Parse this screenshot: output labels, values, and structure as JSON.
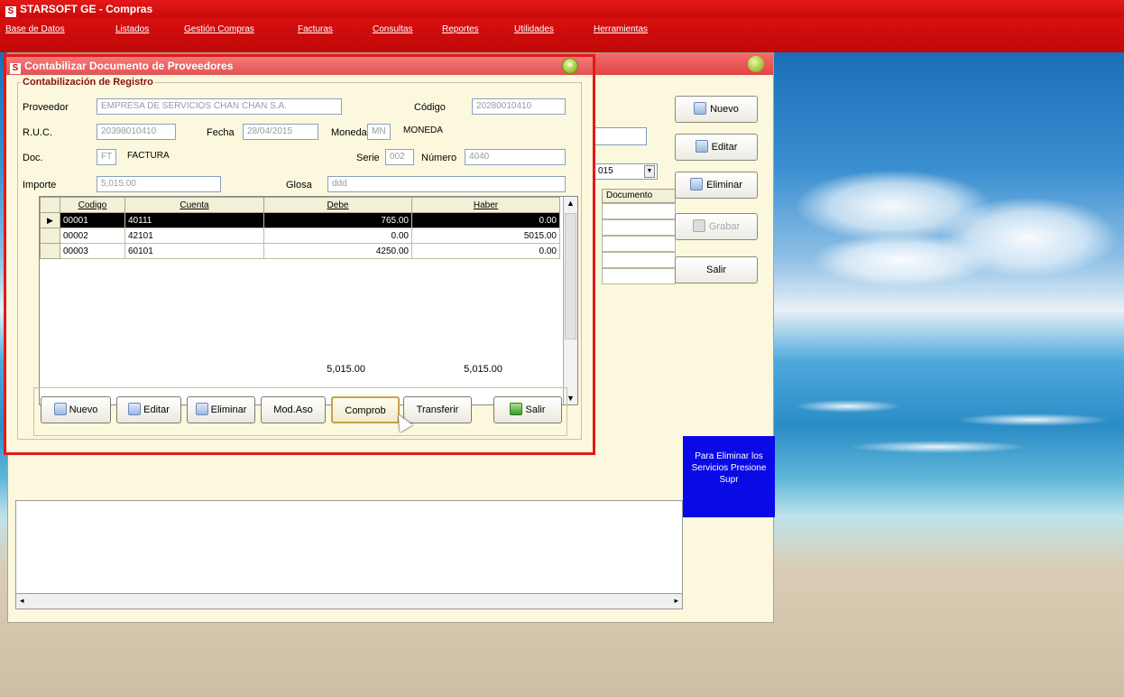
{
  "app": {
    "title": "STARSOFT GE - Compras",
    "logo_letter": "S"
  },
  "menu": [
    {
      "label": "Base de Datos"
    },
    {
      "label": "Listados"
    },
    {
      "label": "Gestión Compras"
    },
    {
      "label": "Facturas"
    },
    {
      "label": "Consultas"
    },
    {
      "label": "Reportes"
    },
    {
      "label": "Utilidades"
    },
    {
      "label": "Herramientas"
    }
  ],
  "background_window": {
    "year_value": "015",
    "grid_header": "Documento",
    "side_buttons": [
      {
        "label": "Nuevo",
        "enabled": true
      },
      {
        "label": "Editar",
        "enabled": true
      },
      {
        "label": "Eliminar",
        "enabled": true
      },
      {
        "label": "Grabar",
        "enabled": false
      },
      {
        "label": "Salir",
        "enabled": true
      }
    ],
    "info_text": "Para Eliminar los Servicios Presione Supr"
  },
  "modal": {
    "title": "Contabilizar Documento de Proveedores",
    "close_glyph": "×",
    "group_legend": "Contabilización de Registro",
    "fields": {
      "proveedor_label": "Proveedor",
      "proveedor_value": "EMPRESA DE SERVICIOS CHAN CHAN S.A.",
      "codigo_label": "Código",
      "codigo_value": "20280010410",
      "ruc_label": "R.U.C.",
      "ruc_value": "20398010410",
      "fecha_label": "Fecha",
      "fecha_value": "28/04/2015",
      "moneda_label": "Moneda",
      "moneda_code": "MN",
      "moneda_name": "MONEDA",
      "doc_label": "Doc.",
      "doc_code": "FT",
      "doc_name": "FACTURA",
      "serie_label": "Serie",
      "serie_value": "002",
      "numero_label": "Número",
      "numero_value": "4040",
      "importe_label": "Importe",
      "importe_value": "5,015.00",
      "glosa_label": "Glosa",
      "glosa_value": "ddd"
    },
    "grid": {
      "columns": [
        "Codigo",
        "Cuenta",
        "Debe",
        "Haber"
      ],
      "rows": [
        {
          "codigo": "00001",
          "cuenta": "40111",
          "debe": "765.00",
          "haber": "0.00",
          "active": true
        },
        {
          "codigo": "00002",
          "cuenta": "42101",
          "debe": "0.00",
          "haber": "5015.00",
          "active": false
        },
        {
          "codigo": "00003",
          "cuenta": "60101",
          "debe": "4250.00",
          "haber": "0.00",
          "active": false
        }
      ],
      "total_debe": "5,015.00",
      "total_haber": "5,015.00"
    },
    "buttons": [
      {
        "label": "Nuevo"
      },
      {
        "label": "Editar"
      },
      {
        "label": "Eliminar"
      },
      {
        "label": "Mod.Aso"
      },
      {
        "label": "Comprob"
      },
      {
        "label": "Transferir"
      },
      {
        "label": "Salir"
      }
    ]
  }
}
